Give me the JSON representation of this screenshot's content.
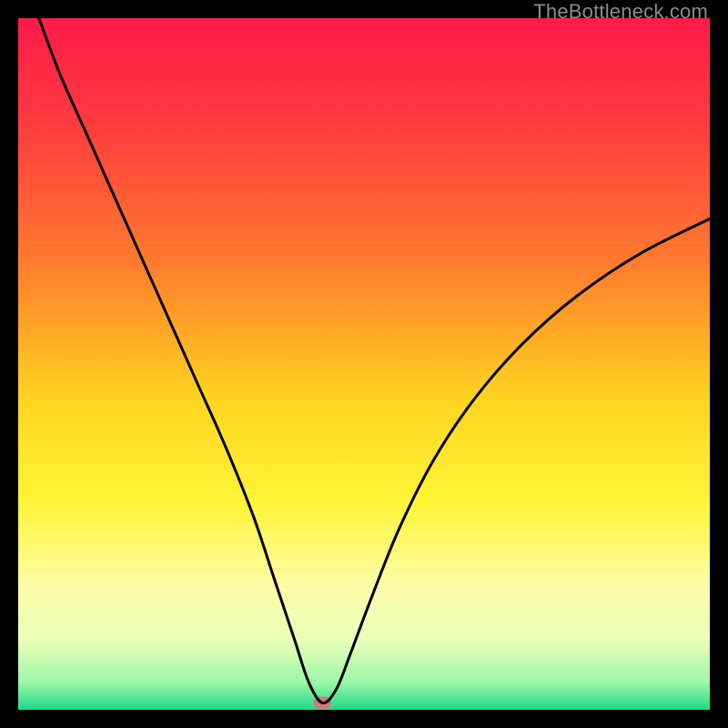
{
  "watermark": "TheBottleneck.com",
  "chart_data": {
    "type": "line",
    "title": "",
    "xlabel": "",
    "ylabel": "",
    "xlim": [
      0,
      100
    ],
    "ylim": [
      0,
      100
    ],
    "background_gradient_stops": [
      {
        "offset": 0.0,
        "color": "#ff1a4a"
      },
      {
        "offset": 0.15,
        "color": "#ff3a3f"
      },
      {
        "offset": 0.35,
        "color": "#ff7a2e"
      },
      {
        "offset": 0.55,
        "color": "#ffd41f"
      },
      {
        "offset": 0.7,
        "color": "#fff537"
      },
      {
        "offset": 0.82,
        "color": "#fdfca8"
      },
      {
        "offset": 0.9,
        "color": "#e9ffb8"
      },
      {
        "offset": 0.96,
        "color": "#9cf7a8"
      },
      {
        "offset": 1.0,
        "color": "#1fd88a"
      }
    ],
    "marker": {
      "x": 44,
      "y": 1,
      "color": "#cf7a7a",
      "rx": 10,
      "ry": 7
    },
    "curve_points": [
      {
        "x": 3,
        "y": 100
      },
      {
        "x": 6,
        "y": 92
      },
      {
        "x": 10,
        "y": 83
      },
      {
        "x": 14,
        "y": 74
      },
      {
        "x": 18,
        "y": 65
      },
      {
        "x": 22,
        "y": 56
      },
      {
        "x": 26,
        "y": 47
      },
      {
        "x": 30,
        "y": 38
      },
      {
        "x": 34,
        "y": 28
      },
      {
        "x": 37,
        "y": 19
      },
      {
        "x": 40,
        "y": 10
      },
      {
        "x": 42,
        "y": 4
      },
      {
        "x": 44,
        "y": 1
      },
      {
        "x": 46,
        "y": 3
      },
      {
        "x": 48,
        "y": 8
      },
      {
        "x": 51,
        "y": 16
      },
      {
        "x": 55,
        "y": 26
      },
      {
        "x": 60,
        "y": 36
      },
      {
        "x": 66,
        "y": 45
      },
      {
        "x": 73,
        "y": 53
      },
      {
        "x": 81,
        "y": 60
      },
      {
        "x": 90,
        "y": 66
      },
      {
        "x": 100,
        "y": 71
      }
    ]
  }
}
